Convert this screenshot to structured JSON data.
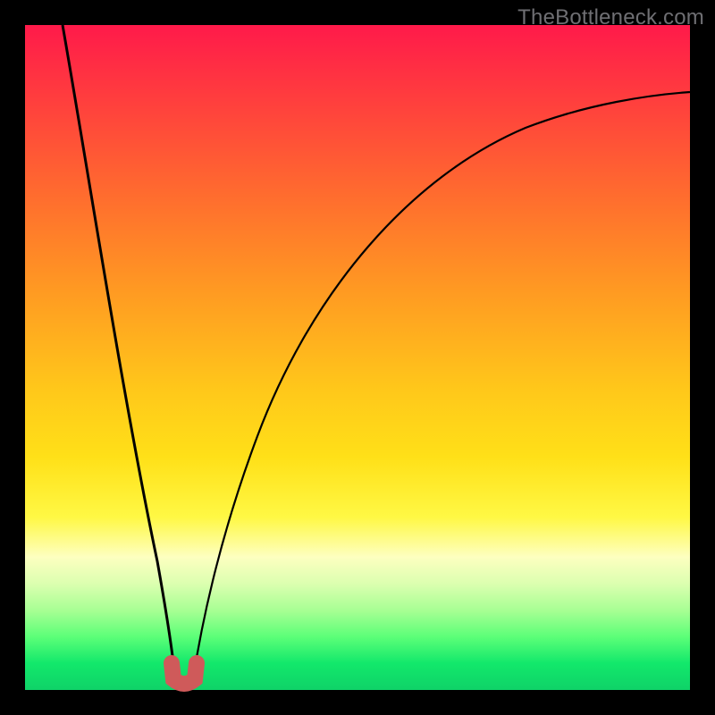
{
  "watermark": "TheBottleneck.com",
  "colors": {
    "frame": "#000000",
    "curve": "#000000",
    "marker": "#cf5a5a",
    "gradient_top": "#ff1a4a",
    "gradient_bottom": "#0fd268"
  },
  "chart_data": {
    "type": "line",
    "title": "",
    "xlabel": "",
    "ylabel": "",
    "xlim": [
      0,
      100
    ],
    "ylim": [
      0,
      100
    ],
    "x": [
      0,
      2,
      4,
      6,
      8,
      10,
      12,
      14,
      16,
      18,
      19,
      20,
      21,
      22,
      23,
      24,
      25,
      26,
      28,
      30,
      32,
      35,
      40,
      45,
      50,
      55,
      60,
      65,
      70,
      75,
      80,
      85,
      90,
      95,
      100
    ],
    "y": [
      100,
      93,
      85,
      77,
      69,
      60,
      51,
      42,
      32,
      21,
      15,
      9,
      4,
      0,
      0,
      0,
      4,
      10,
      20,
      29,
      36,
      45,
      56,
      64,
      70,
      75,
      78,
      81,
      83,
      85,
      86,
      87,
      88,
      88,
      88
    ],
    "minimum_region": {
      "x_start": 21.5,
      "x_end": 24.5,
      "y": 0
    },
    "grid": false,
    "axes_visible": false,
    "legend": false,
    "annotations": []
  }
}
